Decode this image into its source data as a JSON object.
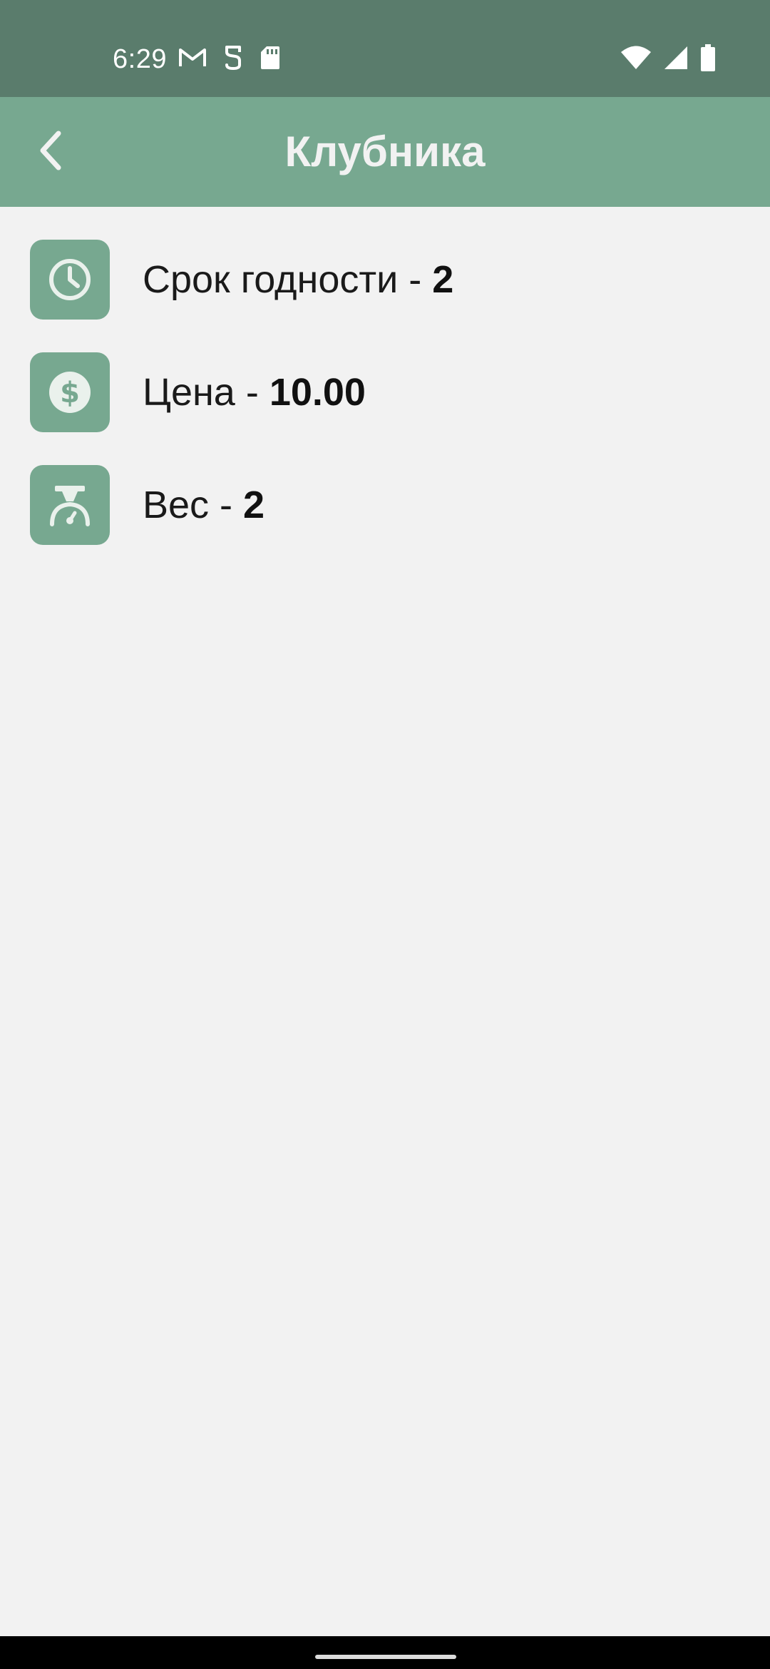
{
  "status_bar": {
    "time": "6:29",
    "left_icons": [
      "gmail-icon",
      "sim-toolkit-icon",
      "sd-card-icon"
    ],
    "right_icons": [
      "wifi-icon",
      "signal-icon",
      "battery-icon"
    ],
    "background": "#5a7c6c"
  },
  "app_bar": {
    "title": "Клубника",
    "back_icon": "chevron-left-icon",
    "background": "#77a890"
  },
  "details": [
    {
      "icon": "clock-icon",
      "label": "Срок годности - ",
      "value": "2"
    },
    {
      "icon": "dollar-icon",
      "label": "Цена - ",
      "value": "10.00"
    },
    {
      "icon": "scale-icon",
      "label": "Вес - ",
      "value": "2"
    }
  ],
  "colors": {
    "accent": "#77a890",
    "background": "#f2f2f2",
    "text": "#1a1a1a"
  }
}
